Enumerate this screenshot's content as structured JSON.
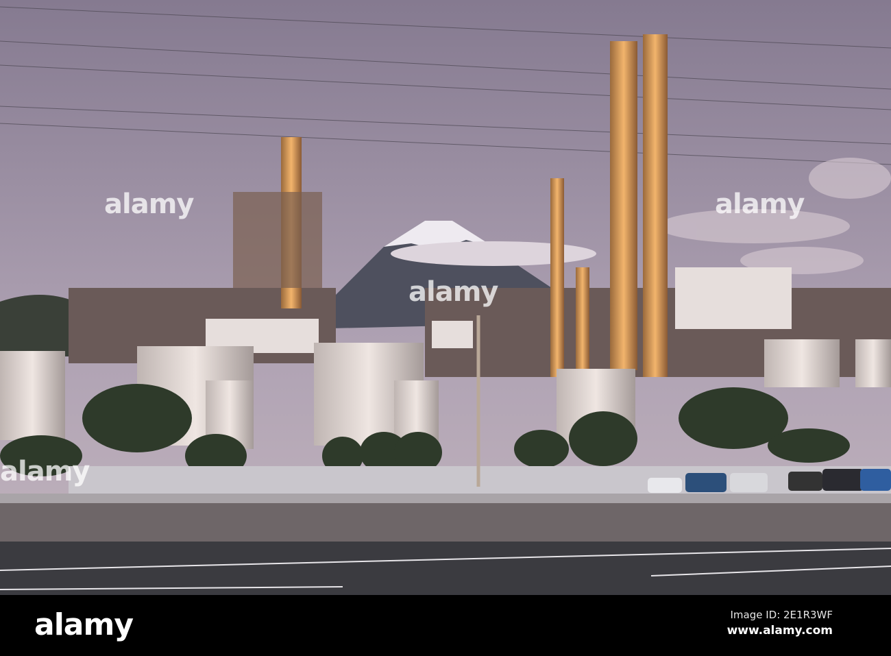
{
  "photo": {
    "colors": {
      "sky_top": "#8a7f95",
      "sky_bottom": "#b6a9b8",
      "tower": "#e8a25a",
      "tank": "#e4dcd8",
      "road": "#3c3c40"
    }
  },
  "watermark": {
    "text": "alamy"
  },
  "footer": {
    "logo": "alamy",
    "image_id": "Image ID: 2E1R3WF",
    "url": "www.alamy.com"
  }
}
